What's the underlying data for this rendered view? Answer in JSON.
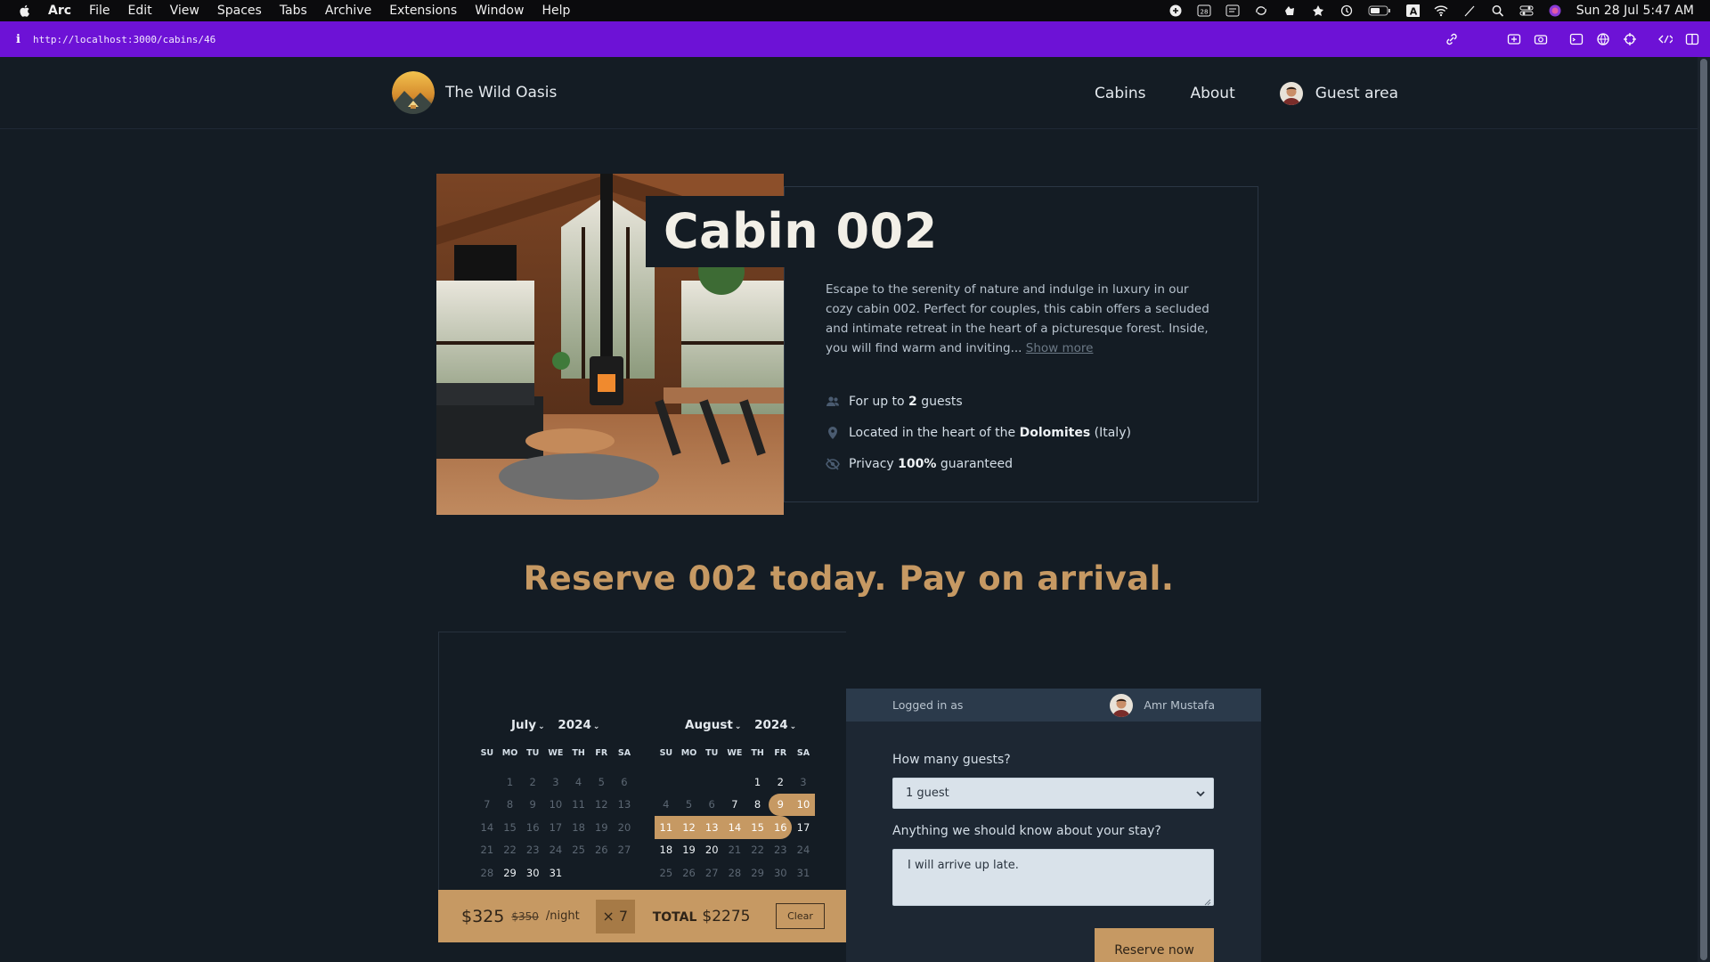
{
  "menubar": {
    "app": "Arc",
    "items": [
      "File",
      "Edit",
      "View",
      "Spaces",
      "Tabs",
      "Archive",
      "Extensions",
      "Window",
      "Help"
    ],
    "calendar_badge": "28",
    "clock": "Sun 28 Jul  5:47 AM"
  },
  "browser": {
    "info_glyph": "i",
    "url": "http://localhost:3000/cabins/46",
    "accent": "#6d12d6"
  },
  "site": {
    "name": "The Wild Oasis",
    "nav": {
      "cabins": "Cabins",
      "about": "About",
      "guest": "Guest area"
    }
  },
  "cabin": {
    "title": "Cabin 002",
    "description": "Escape to the serenity of nature and indulge in luxury in our cozy cabin 002. Perfect for couples, this cabin offers a secluded and intimate retreat in the heart of a picturesque forest. Inside, you will find warm and inviting...",
    "show_more": "Show more",
    "facts": {
      "guests_pre": "For up to ",
      "guests_num": "2",
      "guests_post": " guests",
      "loc_pre": "Located in the heart of the ",
      "loc_bold": "Dolomites",
      "loc_post": " (Italy)",
      "priv_pre": "Privacy ",
      "priv_bold": "100%",
      "priv_post": " guaranteed"
    }
  },
  "reserve": {
    "heading": "Reserve 002 today. Pay on arrival."
  },
  "calendar": {
    "weekdays": [
      "SU",
      "MO",
      "TU",
      "WE",
      "TH",
      "FR",
      "SA"
    ],
    "months": [
      {
        "month": "July",
        "year": "2024",
        "rows": [
          [
            {
              "t": "",
              "s": "blank"
            },
            {
              "t": "1",
              "s": "dim"
            },
            {
              "t": "2",
              "s": "dim"
            },
            {
              "t": "3",
              "s": "dim"
            },
            {
              "t": "4",
              "s": "dim"
            },
            {
              "t": "5",
              "s": "dim"
            },
            {
              "t": "6",
              "s": "dim"
            }
          ],
          [
            {
              "t": "7",
              "s": "dim"
            },
            {
              "t": "8",
              "s": "dim"
            },
            {
              "t": "9",
              "s": "dim"
            },
            {
              "t": "10",
              "s": "dim"
            },
            {
              "t": "11",
              "s": "dim"
            },
            {
              "t": "12",
              "s": "dim"
            },
            {
              "t": "13",
              "s": "dim"
            }
          ],
          [
            {
              "t": "14",
              "s": "dim"
            },
            {
              "t": "15",
              "s": "dim"
            },
            {
              "t": "16",
              "s": "dim"
            },
            {
              "t": "17",
              "s": "dim"
            },
            {
              "t": "18",
              "s": "dim"
            },
            {
              "t": "19",
              "s": "dim"
            },
            {
              "t": "20",
              "s": "dim"
            }
          ],
          [
            {
              "t": "21",
              "s": "dim"
            },
            {
              "t": "22",
              "s": "dim"
            },
            {
              "t": "23",
              "s": "dim"
            },
            {
              "t": "24",
              "s": "dim"
            },
            {
              "t": "25",
              "s": "dim"
            },
            {
              "t": "26",
              "s": "dim"
            },
            {
              "t": "27",
              "s": "dim"
            }
          ],
          [
            {
              "t": "28",
              "s": "dim"
            },
            {
              "t": "29",
              "s": "on"
            },
            {
              "t": "30",
              "s": "on"
            },
            {
              "t": "31",
              "s": "on"
            },
            {
              "t": "",
              "s": "blank"
            },
            {
              "t": "",
              "s": "blank"
            },
            {
              "t": "",
              "s": "blank"
            }
          ]
        ]
      },
      {
        "month": "August",
        "year": "2024",
        "rows": [
          [
            {
              "t": "",
              "s": "blank"
            },
            {
              "t": "",
              "s": "blank"
            },
            {
              "t": "",
              "s": "blank"
            },
            {
              "t": "",
              "s": "blank"
            },
            {
              "t": "1",
              "s": "on"
            },
            {
              "t": "2",
              "s": "on"
            },
            {
              "t": "3",
              "s": "dim"
            }
          ],
          [
            {
              "t": "4",
              "s": "dim"
            },
            {
              "t": "5",
              "s": "dim"
            },
            {
              "t": "6",
              "s": "dim"
            },
            {
              "t": "7",
              "s": "on"
            },
            {
              "t": "8",
              "s": "on"
            },
            {
              "t": "9",
              "s": "sel start"
            },
            {
              "t": "10",
              "s": "sel"
            }
          ],
          [
            {
              "t": "11",
              "s": "sel"
            },
            {
              "t": "12",
              "s": "sel"
            },
            {
              "t": "13",
              "s": "sel"
            },
            {
              "t": "14",
              "s": "sel"
            },
            {
              "t": "15",
              "s": "sel"
            },
            {
              "t": "16",
              "s": "sel end"
            },
            {
              "t": "17",
              "s": "on"
            }
          ],
          [
            {
              "t": "18",
              "s": "on"
            },
            {
              "t": "19",
              "s": "on"
            },
            {
              "t": "20",
              "s": "on"
            },
            {
              "t": "21",
              "s": "dim"
            },
            {
              "t": "22",
              "s": "dim"
            },
            {
              "t": "23",
              "s": "dim"
            },
            {
              "t": "24",
              "s": "dim"
            }
          ],
          [
            {
              "t": "25",
              "s": "dim"
            },
            {
              "t": "26",
              "s": "dim"
            },
            {
              "t": "27",
              "s": "dim"
            },
            {
              "t": "28",
              "s": "dim"
            },
            {
              "t": "29",
              "s": "dim"
            },
            {
              "t": "30",
              "s": "dim"
            },
            {
              "t": "31",
              "s": "dim"
            }
          ]
        ]
      }
    ]
  },
  "price": {
    "discounted": "$325",
    "regular": "$350",
    "per_night": "/night",
    "nights": "× 7",
    "total_label": "TOTAL",
    "total": "$2275",
    "clear": "Clear"
  },
  "form": {
    "logged_in_as": "Logged in as",
    "user_name": "Amr Mustafa",
    "guests_label": "How many guests?",
    "guests_value": "1 guest",
    "notes_label": "Anything we should know about your stay?",
    "notes_value": "I will arrive up late.",
    "submit": "Reserve now"
  },
  "colors": {
    "background": "#141c24",
    "accent": "#c69963",
    "panel": "#1d2733",
    "panel_header": "#2b3a4b"
  }
}
